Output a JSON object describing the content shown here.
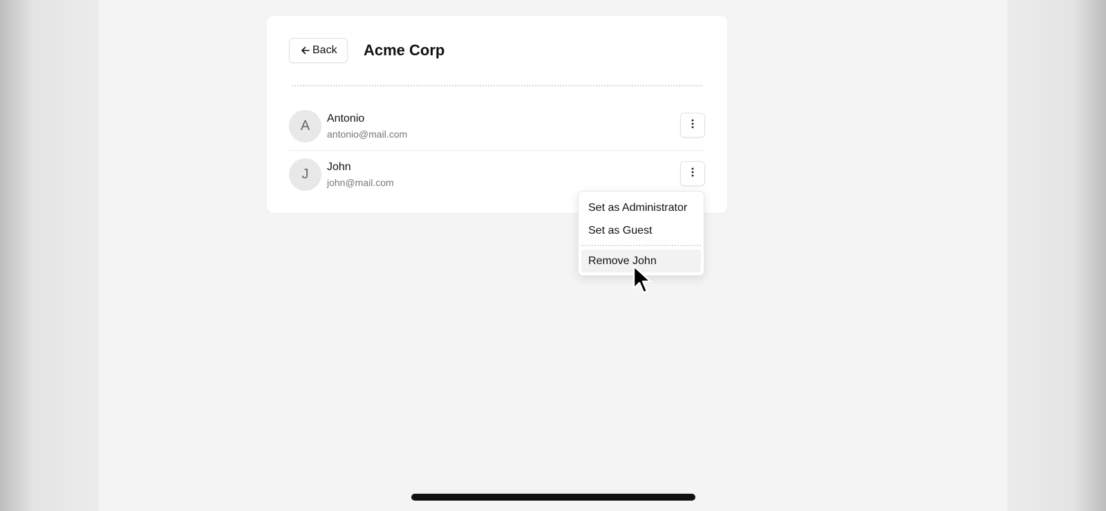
{
  "header": {
    "back_label": "Back",
    "title": "Acme Corp"
  },
  "members": [
    {
      "initial": "A",
      "name": "Antonio",
      "email": "antonio@mail.com"
    },
    {
      "initial": "J",
      "name": "John",
      "email": "john@mail.com"
    }
  ],
  "menu": {
    "items": [
      {
        "label": "Set as Administrator"
      },
      {
        "label": "Set as Guest"
      },
      {
        "label": "Remove John",
        "highlighted": true
      }
    ]
  },
  "icons": {
    "back": "arrow-left-icon",
    "more": "kebab-vertical-icon",
    "cursor": "mouse-pointer-icon"
  },
  "colors": {
    "background": "#f4f4f4",
    "card": "#ffffff",
    "text": "#111111",
    "muted_text": "#777777",
    "avatar_bg": "#e8e8e8",
    "highlight": "#f2f2f2"
  }
}
